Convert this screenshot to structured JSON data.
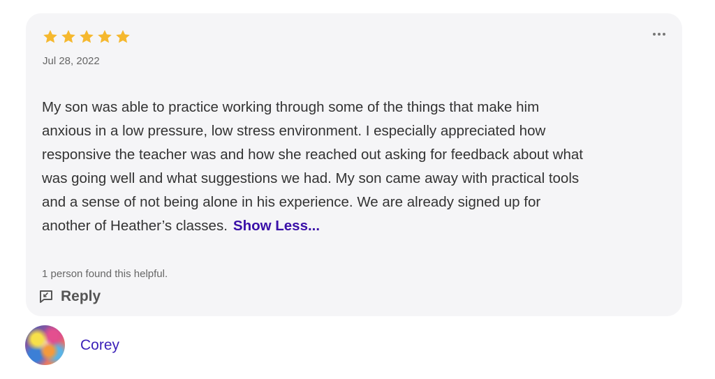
{
  "review": {
    "rating": 5,
    "rating_max": 5,
    "star_color": "#f5b82e",
    "date": "Jul 28, 2022",
    "text": "My son was able to practice working through some of the things that make him\nanxious in a low pressure, low stress environment. I especially appreciated how\nresponsive the teacher was and how she reached out asking for feedback about what\nwas going well and what suggestions we had.  My son came away with practical tools\nand a sense of not being alone in his experience.  We are already signed up for\nanother of Heather’s classes.",
    "show_less_label": "Show Less...",
    "helpful_text": "1 person found this helpful.",
    "reply_label": "Reply",
    "more_icon": "more-horizontal-icon"
  },
  "author": {
    "name": "Corey",
    "avatar_icon": "avatar-image"
  },
  "colors": {
    "card_bg": "#f5f5f7",
    "link": "#3a10a8",
    "author_name": "#3a1fb8"
  }
}
